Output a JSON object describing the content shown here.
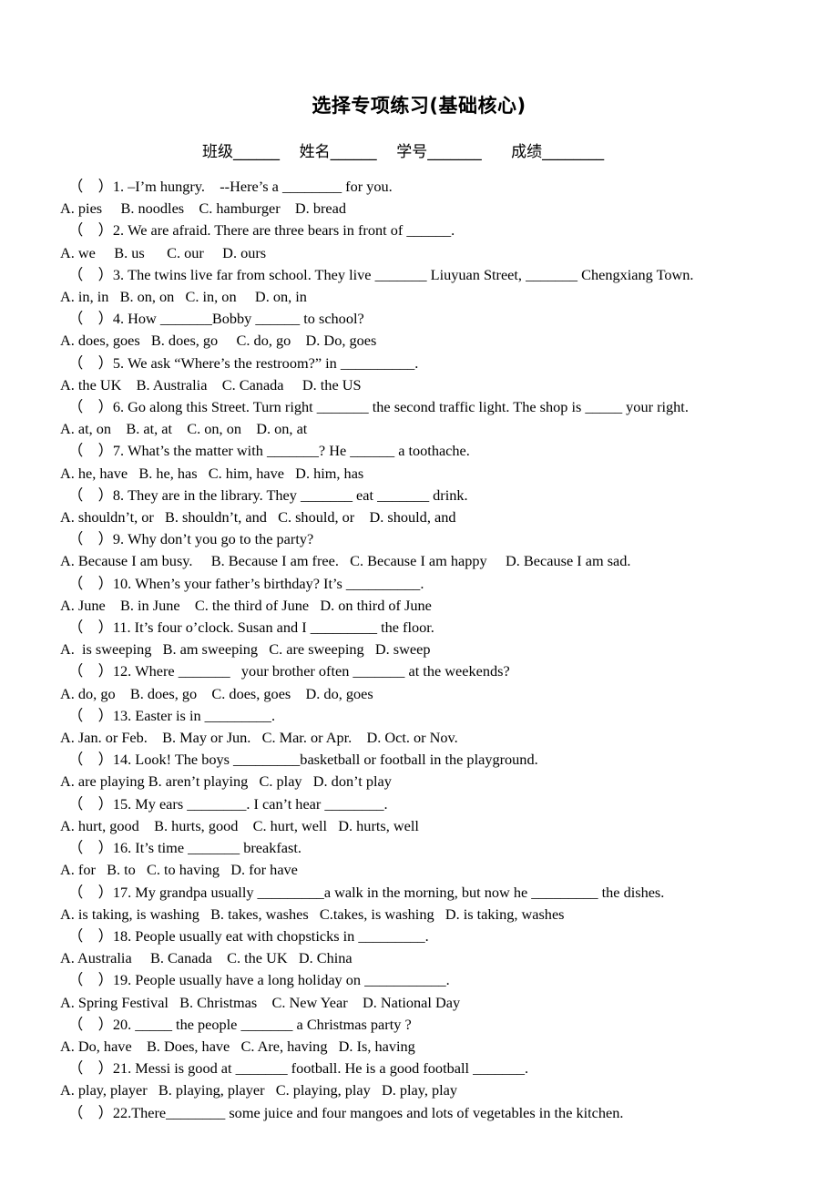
{
  "document": {
    "title": "选择专项练习(基础核心)",
    "info_line": {
      "class_label": "班级",
      "name_label": "姓名",
      "student_id_label": "学号",
      "score_label": "成绩",
      "blank": "_______",
      "full_text": "班级______    姓名______    学号_______      成绩________"
    },
    "answer_bracket": "（    ）"
  },
  "questions": [
    {
      "number": "1.",
      "stem": "（    ）1. –I’m hungry.    --Here’s a ________ for you.",
      "options": "A. pies     B. noodles    C. hamburger    D. bread"
    },
    {
      "number": "2.",
      "stem": "（    ）2. We are afraid. There are three bears in front of ______.",
      "options": "A. we     B. us      C. our     D. ours"
    },
    {
      "number": "3.",
      "stem": "（    ）3. The twins live far from school. They live _______ Liuyuan Street, _______ Chengxiang Town.",
      "options": "A. in, in   B. on, on   C. in, on     D. on, in"
    },
    {
      "number": "4.",
      "stem": "（    ）4. How _______Bobby ______ to school?",
      "options": "A. does, goes   B. does, go     C. do, go    D. Do, goes"
    },
    {
      "number": "5.",
      "stem": "（    ）5. We ask “Where’s the restroom?” in __________.",
      "options": "A. the UK    B. Australia    C. Canada     D. the US"
    },
    {
      "number": "6.",
      "stem": "（    ）6. Go along this Street. Turn right _______ the second traffic light. The shop is _____ your right.",
      "options": "A. at, on    B. at, at    C. on, on    D. on, at"
    },
    {
      "number": "7.",
      "stem": "（    ）7. What’s the matter with _______? He ______ a toothache.",
      "options": "A. he, have   B. he, has   C. him, have   D. him, has"
    },
    {
      "number": "8.",
      "stem": "（    ）8. They are in the library. They _______ eat _______ drink.",
      "options": "A. shouldn’t, or   B. shouldn’t, and   C. should, or    D. should, and"
    },
    {
      "number": "9.",
      "stem": "（    ）9. Why don’t you go to the party?",
      "options": "A. Because I am busy.     B. Because I am free.   C. Because I am happy     D. Because I am sad."
    },
    {
      "number": "10.",
      "stem": "（    ）10. When’s your father’s birthday? It’s __________.",
      "options": "A. June    B. in June    C. the third of June   D. on third of June"
    },
    {
      "number": "11.",
      "stem": "（    ）11. It’s four o’clock. Susan and I _________ the floor.",
      "options": "A.  is sweeping   B. am sweeping   C. are sweeping   D. sweep"
    },
    {
      "number": "12.",
      "stem": "（    ）12. Where _______   your brother often _______ at the weekends?",
      "options": "A. do, go    B. does, go    C. does, goes    D. do, goes"
    },
    {
      "number": "13.",
      "stem": "（    ）13. Easter is in _________.",
      "options": "A. Jan. or Feb.    B. May or Jun.   C. Mar. or Apr.    D. Oct. or Nov."
    },
    {
      "number": "14.",
      "stem": "（    ）14. Look! The boys _________basketball or football in the playground.",
      "options": "A. are playing B. aren’t playing   C. play   D. don’t play"
    },
    {
      "number": "15.",
      "stem": "（    ）15. My ears ________. I can’t hear ________.",
      "options": "A. hurt, good    B. hurts, good    C. hurt, well   D. hurts, well"
    },
    {
      "number": "16.",
      "stem": "（    ）16. It’s time _______ breakfast.",
      "options": "A. for   B. to   C. to having   D. for have"
    },
    {
      "number": "17.",
      "stem": "（    ）17. My grandpa usually _________a walk in the morning, but now he _________ the dishes.",
      "options": "A. is taking, is washing   B. takes, washes   C.takes, is washing   D. is taking, washes"
    },
    {
      "number": "18.",
      "stem": "（    ）18. People usually eat with chopsticks in _________.",
      "options": "A. Australia     B. Canada    C. the UK   D. China"
    },
    {
      "number": "19.",
      "stem": "（    ）19. People usually have a long holiday on ___________.",
      "options": "A. Spring Festival   B. Christmas    C. New Year    D. National Day"
    },
    {
      "number": "20.",
      "stem": "（    ）20. _____ the people _______ a Christmas party ?",
      "options": "A. Do, have    B. Does, have   C. Are, having   D. Is, having"
    },
    {
      "number": "21.",
      "stem": "（    ）21. Messi is good at _______ football. He is a good football _______.",
      "options": "A. play, player   B. playing, player   C. playing, play   D. play, play"
    },
    {
      "number": "22.",
      "stem": "（    ）22.There________ some juice and four mangoes and lots of vegetables in the kitchen.",
      "options": ""
    }
  ]
}
